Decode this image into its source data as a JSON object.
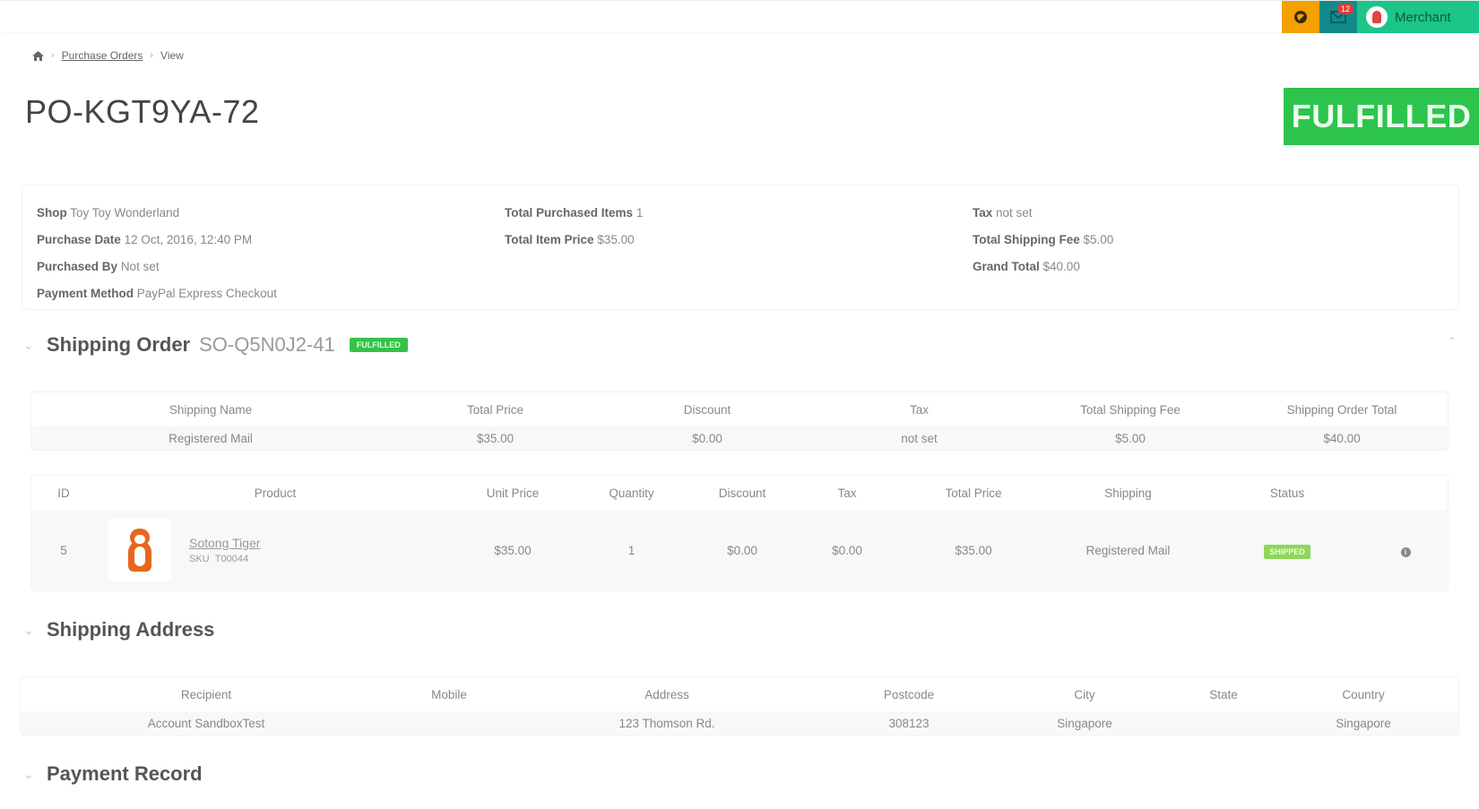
{
  "topbar": {
    "globe_icon": "globe-icon",
    "mail_icon": "mail-icon",
    "mail_badge": "12",
    "user_label": "Merchant"
  },
  "breadcrumb": {
    "home_icon": "home-icon",
    "items": [
      "Purchase Orders",
      "View"
    ],
    "separator": "›"
  },
  "page": {
    "title": "PO-KGT9YA-72",
    "status": "FULFILLED",
    "status_color": "#2dc44d"
  },
  "summary": {
    "col1": [
      {
        "label": "Shop",
        "value": "Toy Toy Wonderland"
      },
      {
        "label": "Purchase Date",
        "value": "12 Oct, 2016, 12:40 PM"
      },
      {
        "label": "Purchased By",
        "value": "Not set"
      },
      {
        "label": "Payment Method",
        "value": "PayPal Express Checkout"
      }
    ],
    "col2": [
      {
        "label": "Total Purchased Items",
        "value": "1"
      },
      {
        "label": "Total Item Price",
        "value": "$35.00"
      }
    ],
    "col3": [
      {
        "label": "Tax",
        "value": "not set"
      },
      {
        "label": "Total Shipping Fee",
        "value": "$5.00"
      },
      {
        "label": "Grand Total",
        "value": "$40.00"
      }
    ]
  },
  "shipping_order": {
    "title": "Shipping Order",
    "id": "SO-Q5N0J2-41",
    "badge": "FULFILLED",
    "summary_table": {
      "headers": [
        "Shipping Name",
        "Total Price",
        "Discount",
        "Tax",
        "Total Shipping Fee",
        "Shipping Order Total"
      ],
      "rows": [
        [
          "Registered Mail",
          "$35.00",
          "$0.00",
          "not set",
          "$5.00",
          "$40.00"
        ]
      ]
    },
    "items_table": {
      "headers": [
        "ID",
        "Product",
        "Unit Price",
        "Quantity",
        "Discount",
        "Tax",
        "Total Price",
        "Shipping",
        "Status",
        ""
      ],
      "rows": [
        {
          "id": "5",
          "product_name": "Sotong Tiger",
          "sku_label": "SKU",
          "sku": "T00044",
          "unit_price": "$35.00",
          "quantity": "1",
          "discount": "$0.00",
          "tax": "$0.00",
          "total_price": "$35.00",
          "shipping": "Registered Mail",
          "status": "SHIPPED",
          "info_icon": "i"
        }
      ]
    }
  },
  "shipping_address": {
    "title": "Shipping Address",
    "headers": [
      "Recipient",
      "Mobile",
      "Address",
      "Postcode",
      "City",
      "State",
      "Country"
    ],
    "rows": [
      [
        "Account SandboxTest",
        "",
        "123 Thomson Rd.",
        "308123",
        "Singapore",
        "",
        "Singapore"
      ]
    ]
  },
  "payment_record": {
    "title": "Payment Record"
  },
  "icons": {
    "chevron": "⌄",
    "chevron_up": "⌃"
  }
}
